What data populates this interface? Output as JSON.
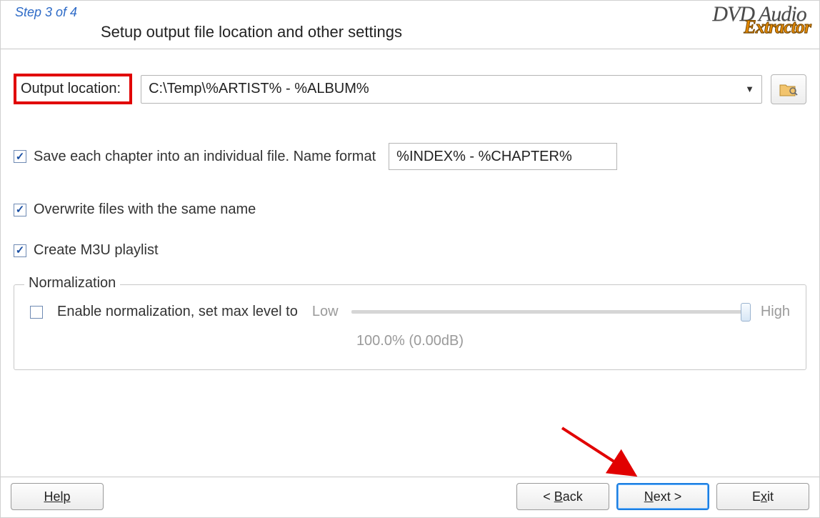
{
  "header": {
    "step_label": "Step 3 of 4",
    "title": "Setup output file location and other settings",
    "logo_top": "DVD Audio",
    "logo_bottom": "Extractor"
  },
  "output": {
    "label": "Output location:",
    "value": "C:\\Temp\\%ARTIST% - %ALBUM%"
  },
  "options": {
    "save_chapter": {
      "checked": true,
      "label": "Save each chapter into an individual file. Name format",
      "name_format": "%INDEX% - %CHAPTER%"
    },
    "overwrite": {
      "checked": true,
      "label": "Overwrite files with the same name"
    },
    "create_m3u": {
      "checked": true,
      "label": "Create M3U playlist"
    }
  },
  "normalization": {
    "legend": "Normalization",
    "enable": {
      "checked": false,
      "label": "Enable normalization, set max level to"
    },
    "low_label": "Low",
    "high_label": "High",
    "value_text": "100.0% (0.00dB)"
  },
  "footer": {
    "help": "Help",
    "back": "< Back",
    "next": "Next >",
    "exit": "Exit"
  }
}
